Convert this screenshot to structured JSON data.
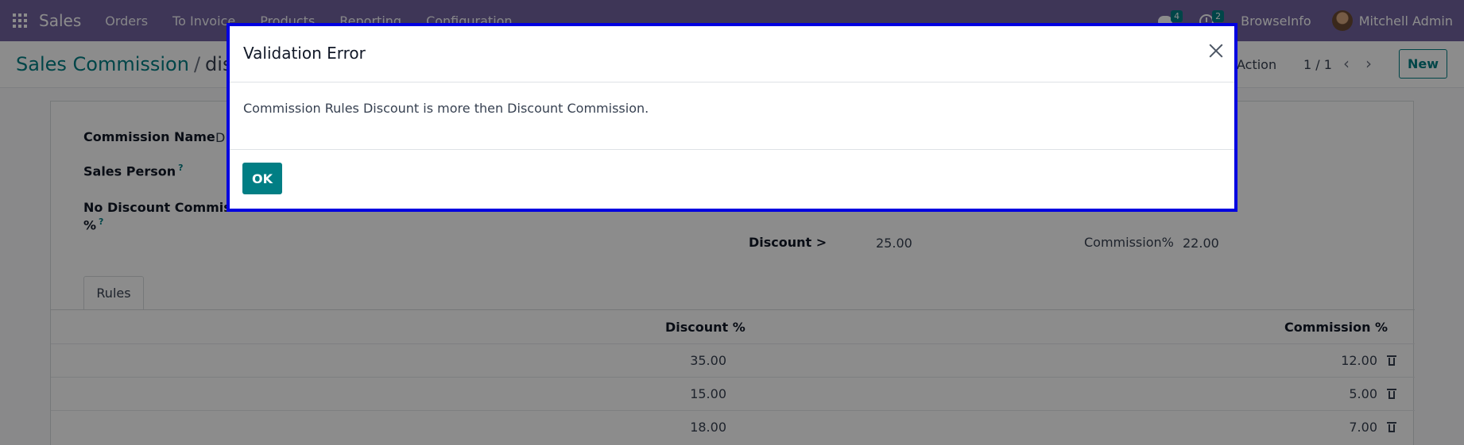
{
  "navbar": {
    "app_name": "Sales",
    "menu": [
      "Orders",
      "To Invoice",
      "Products",
      "Reporting",
      "Configuration"
    ],
    "messages_count": "4",
    "activities_count": "2",
    "company": "BrowseInfo",
    "user": "Mitchell Admin"
  },
  "control_panel": {
    "breadcrumb_parent": "Sales Commission",
    "breadcrumb_separator": "/",
    "breadcrumb_current": "disco",
    "action_label": "Action",
    "pager": "1 / 1",
    "new_button": "New"
  },
  "form": {
    "commission_name_label": "Commission Name",
    "commission_name_value": "D",
    "sales_person_label": "Sales Person",
    "help_mark": "?",
    "no_discount_label_line1": "No Discount Commissi",
    "no_discount_label_line2": "%",
    "discount_gt_label": "Discount >",
    "discount_gt_value": "25.00",
    "commission_pct_label": "Commission%",
    "commission_pct_value": "22.00"
  },
  "rules": {
    "tab_label": "Rules",
    "columns": [
      "Discount %",
      "Commission %"
    ],
    "rows": [
      {
        "discount": "35.00",
        "commission": "12.00"
      },
      {
        "discount": "15.00",
        "commission": "5.00"
      },
      {
        "discount": "18.00",
        "commission": "7.00"
      }
    ]
  },
  "dialog": {
    "title": "Validation Error",
    "message": "Commission Rules Discount is more then Discount Commission.",
    "ok_label": "OK"
  }
}
